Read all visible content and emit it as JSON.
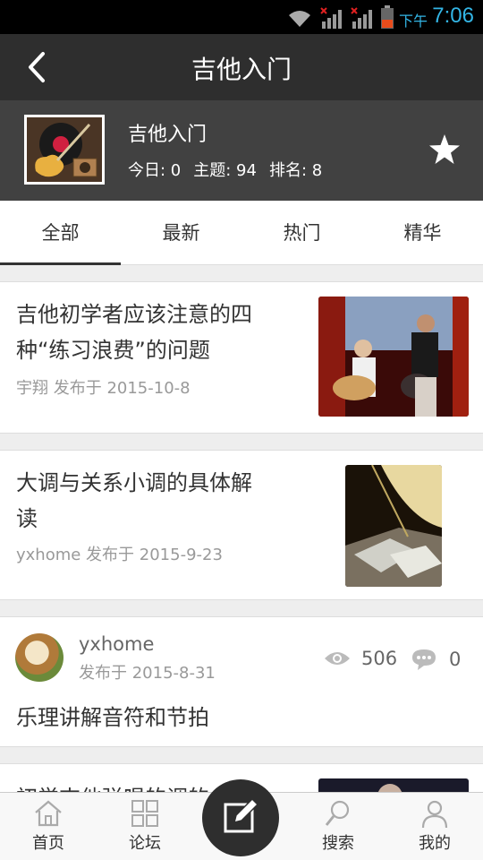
{
  "status_bar": {
    "ampm": "下午",
    "time": "7:06"
  },
  "titlebar": {
    "title": "吉他入门"
  },
  "forum": {
    "name": "吉他入门",
    "today_label": "今日: 0",
    "topics_label": "主题: 94",
    "rank_label": "排名: 8"
  },
  "tabs": [
    {
      "label": "全部"
    },
    {
      "label": "最新"
    },
    {
      "label": "热门"
    },
    {
      "label": "精华"
    }
  ],
  "posts": [
    {
      "title_line1": "吉他初学者应该注意的四",
      "title_line2": "种“练习浪费”的问题",
      "meta": "宇翔 发布于 2015-10-8"
    },
    {
      "title_line1": "大调与关系小调的具体解",
      "title_line2": "读",
      "meta": "yxhome 发布于 2015-9-23"
    },
    {
      "author": "yxhome",
      "date": "发布于 2015-8-31",
      "views": "506",
      "comments": "0",
      "title": "乐理讲解音符和节拍"
    },
    {
      "title_line1": "初学吉他弹唱的调的"
    }
  ],
  "bottom_nav": [
    {
      "label": "首页",
      "icon": "home-icon"
    },
    {
      "label": "论坛",
      "icon": "grid-icon"
    },
    {
      "label": "",
      "icon": "edit-icon"
    },
    {
      "label": "搜索",
      "icon": "search-icon"
    },
    {
      "label": "我的",
      "icon": "user-icon"
    }
  ],
  "colors": {
    "status_accent": "#33b5e5",
    "titlebar": "#2e2e2e",
    "forum_header": "#414141"
  }
}
